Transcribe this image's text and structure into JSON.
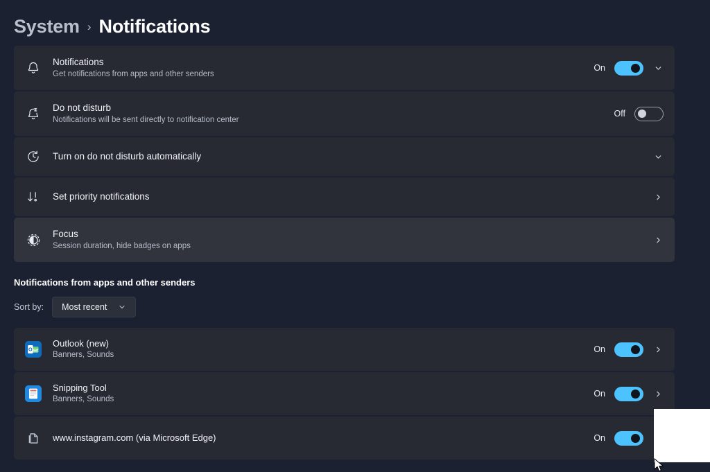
{
  "breadcrumb": {
    "parent": "System",
    "separator": "›",
    "current": "Notifications"
  },
  "settings_rows": [
    {
      "icon": "bell-icon",
      "title": "Notifications",
      "subtitle": "Get notifications from apps and other senders",
      "state_label": "On",
      "toggle": "on",
      "chevron": "chevron-down-icon"
    },
    {
      "icon": "bell-sleep-icon",
      "title": "Do not disturb",
      "subtitle": "Notifications will be sent directly to notification center",
      "state_label": "Off",
      "toggle": "off",
      "chevron": ""
    },
    {
      "icon": "clock-icon",
      "title": "Turn on do not disturb automatically",
      "subtitle": "",
      "state_label": "",
      "toggle": "",
      "chevron": "chevron-down-icon"
    },
    {
      "icon": "priority-sort-icon",
      "title": "Set priority notifications",
      "subtitle": "",
      "state_label": "",
      "toggle": "",
      "chevron": "chevron-right-icon"
    },
    {
      "icon": "focus-icon",
      "title": "Focus",
      "subtitle": "Session duration, hide badges on apps",
      "state_label": "",
      "toggle": "",
      "chevron": "chevron-right-icon"
    }
  ],
  "apps_section": {
    "heading": "Notifications from apps and other senders",
    "sort_label": "Sort by:",
    "sort_value": "Most recent",
    "sort_chevron": "chevron-down-icon",
    "apps": [
      {
        "icon": "outlook-app-icon",
        "name": "Outlook (new)",
        "detail": "Banners, Sounds",
        "state_label": "On",
        "toggle": "on",
        "chevron": "chevron-right-icon"
      },
      {
        "icon": "snipping-tool-app-icon",
        "name": "Snipping Tool",
        "detail": "Banners, Sounds",
        "state_label": "On",
        "toggle": "on",
        "chevron": "chevron-right-icon"
      },
      {
        "icon": "web-page-icon",
        "name": "www.instagram.com (via Microsoft Edge)",
        "detail": "",
        "state_label": "On",
        "toggle": "on",
        "chevron": "chevron-right-icon"
      }
    ]
  },
  "colors": {
    "page_background": "#1b2130",
    "card_background": "#272a33",
    "card_hover": "#31343d",
    "accent_toggle_on": "#4cc2ff",
    "text_primary": "#f2f4f8",
    "text_secondary": "#b6bcc8"
  }
}
